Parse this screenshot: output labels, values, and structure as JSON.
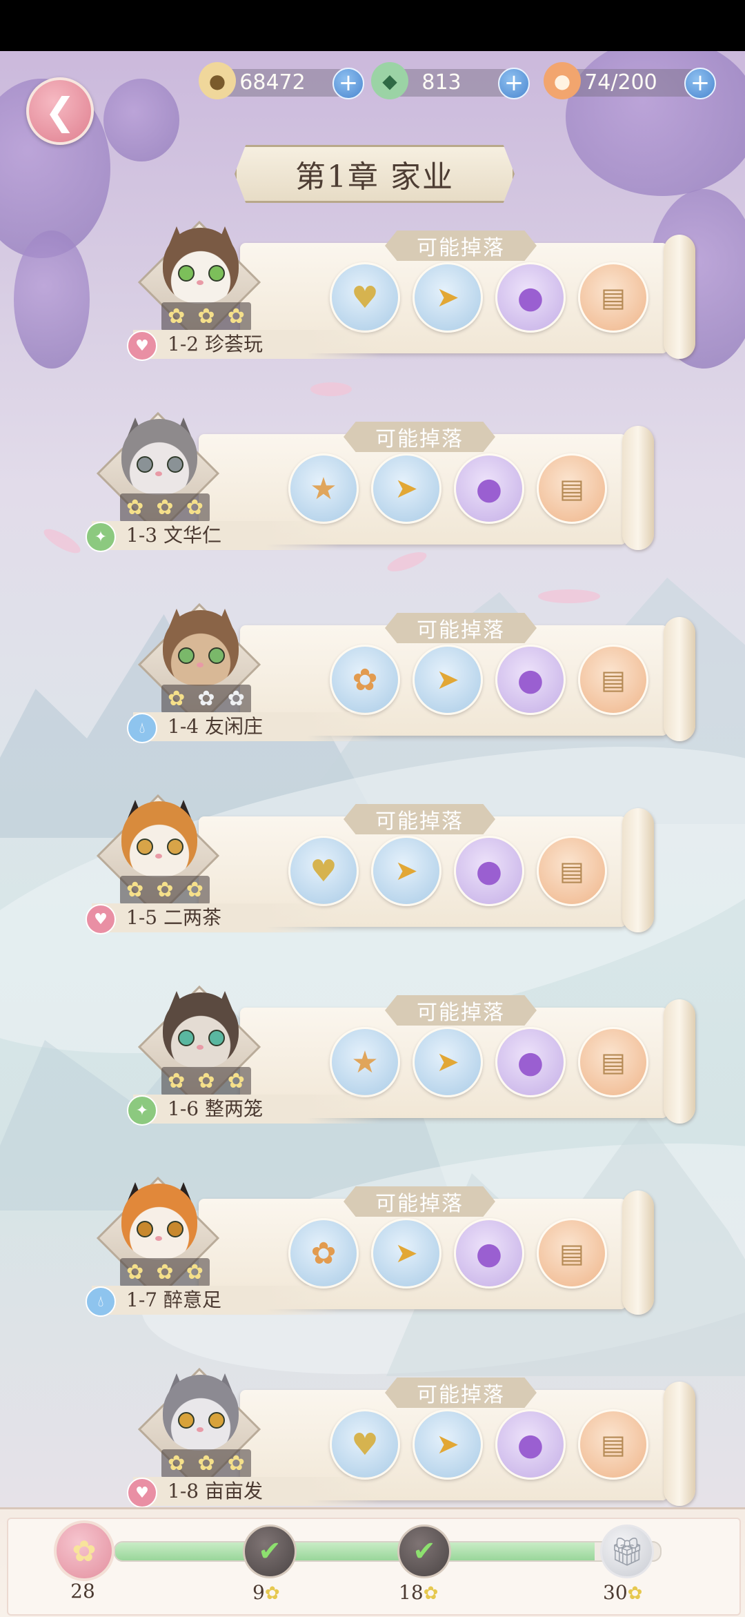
{
  "currencies": [
    {
      "icon": "paw-coin-icon",
      "value": "68472"
    },
    {
      "icon": "green-bird-gem-icon",
      "value": "813"
    },
    {
      "icon": "stamina-basket-icon",
      "value": "74/200"
    }
  ],
  "chapter_title": "第1章  家业",
  "drop_label": "可能掉落",
  "levels": [
    {
      "name": "1-2 珍荟玩",
      "element": "heart",
      "stars": 3,
      "items": [
        "heart-cookie",
        "golden-fish",
        "purple-fish",
        "scroll-pouch"
      ]
    },
    {
      "name": "1-3 文华仁",
      "element": "leaf",
      "stars": 3,
      "items": [
        "rabbit-cookie",
        "golden-fish",
        "purple-fish",
        "scroll-pouch"
      ]
    },
    {
      "name": "1-4 友闲庄",
      "element": "water",
      "stars": 1,
      "items": [
        "flower-cookie",
        "golden-fish",
        "purple-fish",
        "scroll-pouch"
      ]
    },
    {
      "name": "1-5 二两茶",
      "element": "heart",
      "stars": 3,
      "items": [
        "heart-cookie",
        "golden-fish",
        "purple-fish",
        "scroll-pouch"
      ]
    },
    {
      "name": "1-6 整两笼",
      "element": "leaf",
      "stars": 3,
      "items": [
        "rabbit-cookie",
        "golden-fish",
        "purple-fish",
        "scroll-pouch"
      ]
    },
    {
      "name": "1-7 醉意足",
      "element": "water",
      "stars": 3,
      "items": [
        "flower-cookie",
        "golden-fish",
        "purple-fish",
        "scroll-pouch"
      ]
    },
    {
      "name": "1-8 亩亩发",
      "element": "heart",
      "stars": 3,
      "items": [
        "heart-cookie",
        "golden-fish",
        "purple-fish",
        "scroll-pouch"
      ]
    }
  ],
  "progress": {
    "total_stars": "28",
    "fill_fraction": 0.88,
    "milestones": [
      {
        "label": "9",
        "state": "claimed"
      },
      {
        "label": "18",
        "state": "claimed"
      },
      {
        "label": "30",
        "state": "locked-gift"
      }
    ]
  },
  "colors": {
    "accent_pink": "#df7f8f",
    "scroll": "#f1e7d6",
    "progress_green": "#99d69a"
  }
}
